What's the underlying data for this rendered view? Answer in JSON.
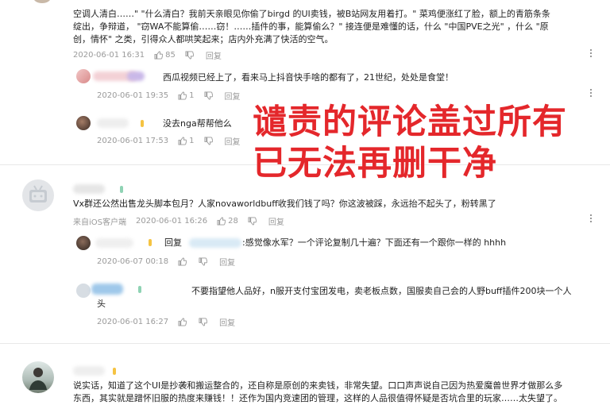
{
  "comments": [
    {
      "id": "c1",
      "text_lines": [
        "空调人清白……\"  \"什么清白？我前天亲眼见你偷了birgd 的UI卖钱，被B站网友用着打。\" 菜鸡便涨红了脸，额上的青筋条条",
        "绽出，争辩道，  \"窃WA不能算偷……窃！……插件的事，能算偷么？\" 接连便是难懂的话，什么 \"中国PVE之光\" ，什么 \"原",
        "创，情怀\" 之类，引得众人都哄笑起来；店内外充满了快活的空气。"
      ],
      "date": "2020-06-01 16:31",
      "likes": "85",
      "reply_label": "回复"
    }
  ],
  "replies_1": [
    {
      "id": "r1",
      "text": "西瓜视频已经上了，看来马上抖音快手啥的都有了，21世纪，处处是食堂！",
      "date": "2020-06-01 19:35",
      "likes": "1",
      "reply_label": "回复"
    },
    {
      "id": "r2",
      "text": "没去nga帮帮他么",
      "date": "2020-06-01 17:53",
      "likes": "1",
      "reply_label": "回复"
    }
  ],
  "comment2": {
    "text": "Vx群还公然出售龙头脚本包月？人家novaworldbuff收我们钱了吗？你这波被踩，永远抬不起头了，粉转黑了",
    "source": "来自iOS客户端",
    "date": "2020-06-01 16:26",
    "likes": "28",
    "reply_label": "回复"
  },
  "replies_2": [
    {
      "id": "r3",
      "prefix": "回复",
      "text": ":感觉像水军？一个评论复制几十遍？下面还有一个跟你一样的  hhhh",
      "date": "2020-06-07 00:18",
      "reply_label": "回复"
    },
    {
      "id": "r4",
      "text_line1": "不要指望他人品好，n服开支付宝团发电，卖老板点数，国服卖自己会的人野buff插件200块一个人",
      "text_line2": "头",
      "date": "2020-06-01 16:27",
      "reply_label": "回复"
    }
  ],
  "comment3": {
    "line1": "说实话，知道了这个UI是抄袭和搬运整合的，还自称是原创的来卖钱，非常失望。口口声声说自己因为热爱魔兽世界才做那么多",
    "line2": "东西，其实就是蹭怀旧服的热度来赚钱！！还作为国内竞速团的管理，这样的人品很值得怀疑是否坑合里的玩家……太失望了。"
  },
  "overlay": {
    "line1": "谴责的评论盖过所有",
    "line2": "已无法再删干净"
  },
  "colors": {
    "overlay_red": "#e4272b",
    "meta_gray": "#9a9a9a",
    "level_badge": "#f5c342"
  }
}
